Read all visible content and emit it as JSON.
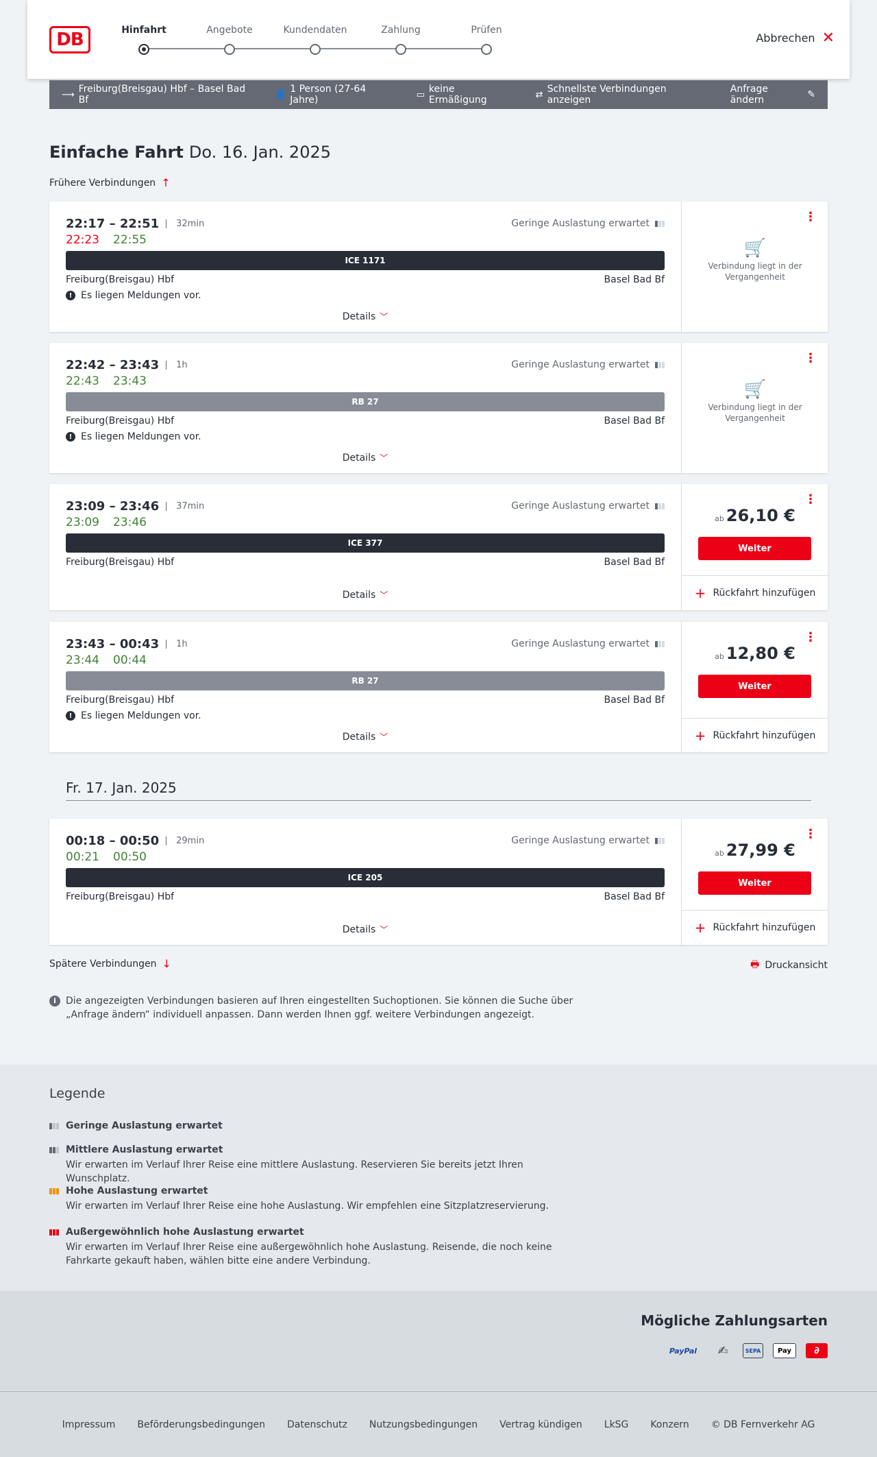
{
  "header": {
    "logo": "DB",
    "steps": [
      "Hinfahrt",
      "Angebote",
      "Kundendaten",
      "Zahlung",
      "Prüfen"
    ],
    "active_step": "Hinfahrt",
    "cancel_label": "Abbrechen"
  },
  "query": {
    "route": "Freiburg(Breisgau) Hbf – Basel Bad Bf",
    "persons": "1 Person (27-64 Jahre)",
    "discount": "keine Ermäßigung",
    "option": "Schnellste Verbindungen anzeigen",
    "change_label": "Anfrage ändern"
  },
  "page": {
    "title": "Einfache Fahrt",
    "date": "Do. 16. Jan. 2025",
    "earlier_label": "Frühere Verbindungen",
    "later_label": "Spätere Verbindungen",
    "print_label": "Druckansicht",
    "info_text": "Die angezeigten Verbindungen basieren auf Ihren eingestellten Suchoptionen. Sie können die Suche über „Anfrage ändern“ individuell anpassen. Dann werden Ihnen ggf. weitere Verbindungen angezeigt.",
    "day2_label": "Fr. 17. Jan. 2025"
  },
  "common": {
    "load_text": "Geringe Auslastung erwartet",
    "details_label": "Details",
    "notice_text": "Es liegen Meldungen vor.",
    "past_text": "Verbindung liegt in der Vergangenheit",
    "price_prefix": "ab",
    "continue_label": "Weiter",
    "return_label": "Rückfahrt hinzufügen"
  },
  "connections": [
    {
      "times": "22:17 – 22:51",
      "duration": "32min",
      "rt_dep": "22:23",
      "rt_arr": "22:55",
      "rt_dep_color": "#ec0016",
      "train": "ICE 1171",
      "from": "Freiburg(Breisgau) Hbf",
      "to": "Basel Bad Bf",
      "notice": true,
      "past": true,
      "price": ""
    },
    {
      "times": "22:42 – 23:43",
      "duration": "1h",
      "rt_dep": "22:43",
      "rt_arr": "23:43",
      "rt_dep_color": "#408335",
      "train": "RB 27",
      "from": "Freiburg(Breisgau) Hbf",
      "to": "Basel Bad Bf",
      "notice": true,
      "past": true,
      "price": ""
    },
    {
      "times": "23:09 – 23:46",
      "duration": "37min",
      "rt_dep": "23:09",
      "rt_arr": "23:46",
      "rt_dep_color": "#408335",
      "train": "ICE 377",
      "from": "Freiburg(Breisgau) Hbf",
      "to": "Basel Bad Bf",
      "notice": false,
      "past": false,
      "price": "26,10 €"
    },
    {
      "times": "23:43 – 00:43",
      "duration": "1h",
      "rt_dep": "23:44",
      "rt_arr": "00:44",
      "rt_dep_color": "#408335",
      "train": "RB 27",
      "from": "Freiburg(Breisgau) Hbf",
      "to": "Basel Bad Bf",
      "notice": true,
      "past": false,
      "price": "12,80 €"
    },
    {
      "times": "00:18 – 00:50",
      "duration": "29min",
      "rt_dep": "00:21",
      "rt_arr": "00:50",
      "rt_dep_color": "#408335",
      "train": "ICE 205",
      "from": "Freiburg(Breisgau) Hbf",
      "to": "Basel Bad Bf",
      "notice": false,
      "past": false,
      "price": "27,99 €"
    }
  ],
  "legend": {
    "title": "Legende",
    "items": [
      {
        "title": "Geringe Auslastung erwartet",
        "desc": ""
      },
      {
        "title": "Mittlere Auslastung erwartet",
        "desc": "Wir erwarten im Verlauf Ihrer Reise eine mittlere Auslastung. Reservieren Sie bereits jetzt Ihren Wunschplatz."
      },
      {
        "title": "Hohe Auslastung erwartet",
        "desc": "Wir erwarten im Verlauf Ihrer Reise eine hohe Auslastung. Wir empfehlen eine Sitzplatzreservierung."
      },
      {
        "title": "Außergewöhnlich hohe Auslastung erwartet",
        "desc": "Wir erwarten im Verlauf Ihrer Reise eine außergewöhnlich hohe Auslastung. Reisende, die noch keine Fahrkarte gekauft haben, wählen bitte eine andere Verbindung."
      }
    ]
  },
  "payment": {
    "title": "Mögliche Zahlungsarten",
    "methods": [
      "PayPal",
      "SEPA",
      "Pay"
    ]
  },
  "footer": {
    "links": [
      "Impressum",
      "Beförderungsbedingungen",
      "Datenschutz",
      "Nutzungsbedingungen",
      "Vertrag kündigen",
      "LkSG",
      "Konzern",
      "© DB Fernverkehr AG"
    ]
  }
}
